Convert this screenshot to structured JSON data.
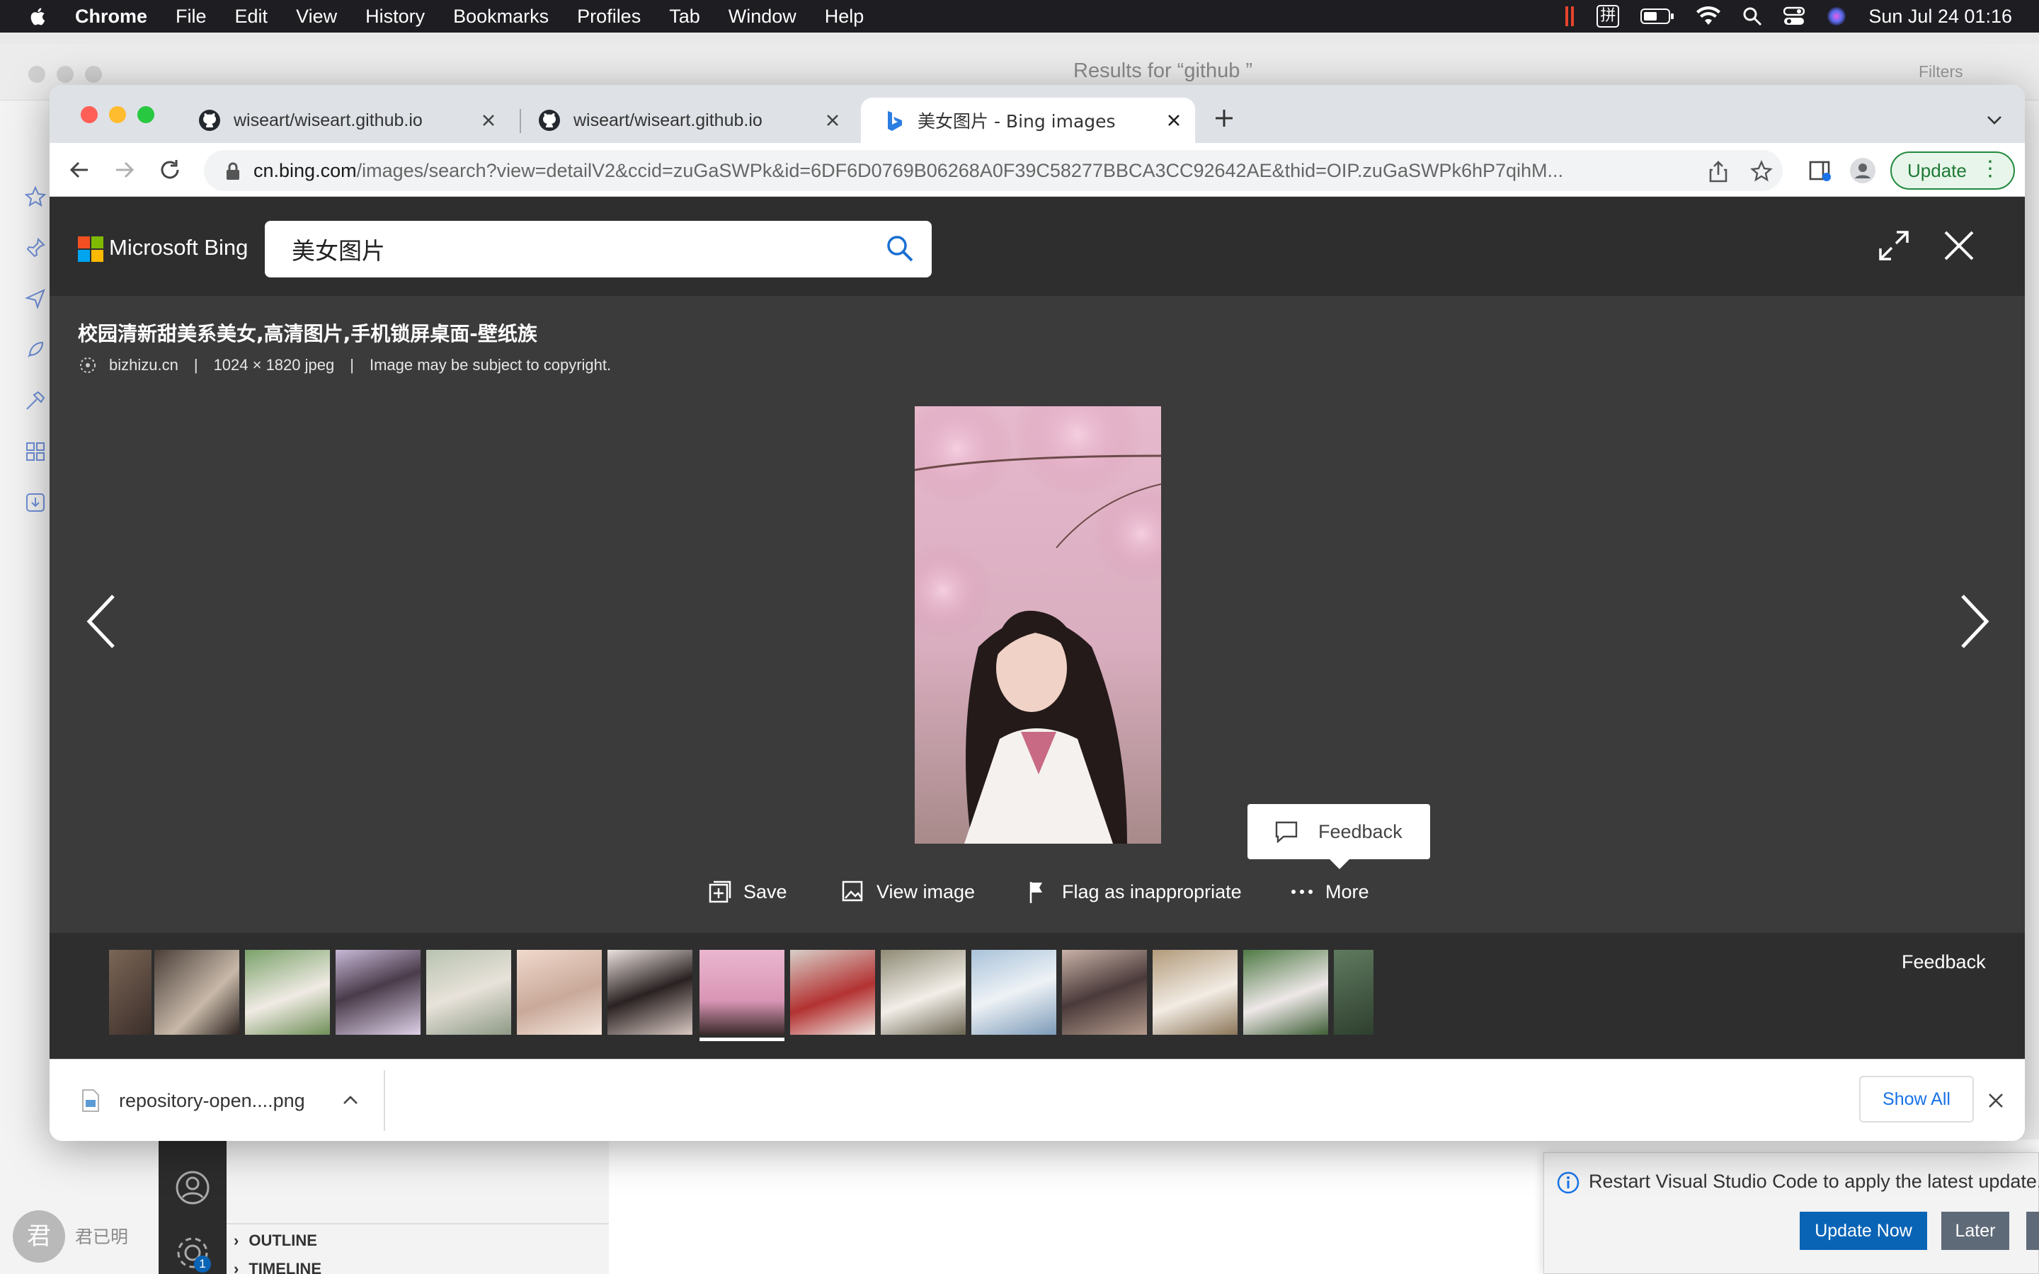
{
  "menubar": {
    "app": "Chrome",
    "items": [
      "File",
      "Edit",
      "View",
      "History",
      "Bookmarks",
      "Profiles",
      "Tab",
      "Window",
      "Help"
    ],
    "input_method": "拼",
    "clock": "Sun Jul 24  01:16"
  },
  "background_window": {
    "title": "Results for “github ”",
    "filters": "Filters"
  },
  "browser": {
    "tabs": [
      {
        "title": "wiseart/wiseart.github.io",
        "icon": "github-icon"
      },
      {
        "title": "wiseart/wiseart.github.io",
        "icon": "github-icon"
      },
      {
        "title": "美女图片 - Bing images",
        "icon": "bing-icon"
      }
    ],
    "url_host": "cn.bing.com",
    "url_path": "/images/search?view=detailV2&ccid=zuGaSWPk&id=6DF6D0769B06268A0F39C58277BBCA3CC92642AE&thid=OIP.zuGaSWPk6hP7qihM...",
    "update_label": "Update"
  },
  "bing": {
    "logo_text": "Microsoft Bing",
    "search_value": "美女图片",
    "image_title": "校园清新甜美系美女,高清图片,手机锁屏桌面-壁纸族",
    "source": "bizhizu.cn",
    "dimensions": "1024 × 1820 jpeg",
    "copyright": "Image may be subject to copyright.",
    "actions": {
      "save": "Save",
      "view_image": "View image",
      "flag": "Flag as inappropriate",
      "more": "More"
    },
    "feedback_popup": "Feedback",
    "strip_feedback": "Feedback",
    "selected_thumb_index": 7
  },
  "downloads": {
    "file": "repository-open....png",
    "show_all": "Show All"
  },
  "vscode": {
    "outline": "OUTLINE",
    "timeline": "TIMELINE",
    "notification": "Restart Visual Studio Code to apply the latest update.",
    "update_now": "Update Now",
    "later": "Later",
    "badge": "1",
    "user_initial": "君",
    "user_name": "君已明"
  },
  "colors": {
    "bing_dark": "#3b3b3b",
    "update_green": "#1e7a35",
    "link_blue": "#1a73e8",
    "vscode_blue": "#0a64b6"
  }
}
